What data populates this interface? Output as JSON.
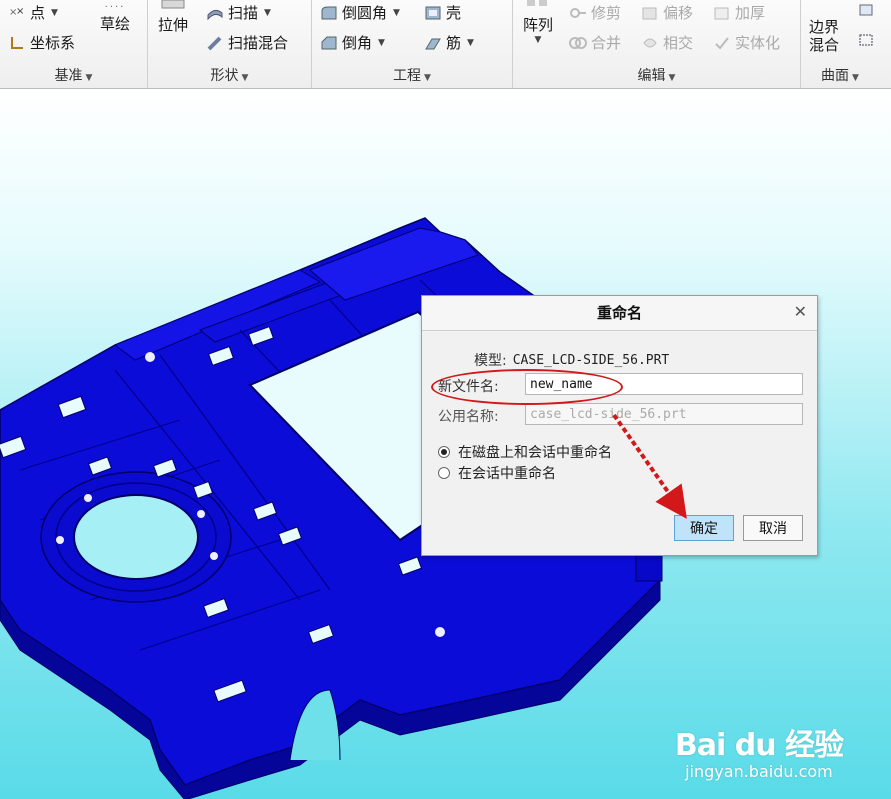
{
  "ribbon": {
    "groups": [
      {
        "label": "基准"
      },
      {
        "label": "形状"
      },
      {
        "label": "工程"
      },
      {
        "label": "编辑"
      },
      {
        "label": "曲面"
      }
    ],
    "datum": {
      "point": "点",
      "csys": "坐标系",
      "sketch": "草绘"
    },
    "shapes": {
      "extrude": "拉伸",
      "sweep": "扫描",
      "swept_blend": "扫描混合"
    },
    "engineering": {
      "round": "倒圆角",
      "chamfer": "倒角",
      "shell": "壳",
      "rib": "筋"
    },
    "editing": {
      "pattern": "阵列",
      "trim": "修剪",
      "merge": "合并",
      "offset": "偏移",
      "intersect": "相交",
      "thicken": "加厚",
      "solidify": "实体化"
    },
    "surfaces": {
      "boundary_blend_1": "边界",
      "boundary_blend_2": "混合"
    }
  },
  "dialog": {
    "title": "重命名",
    "model_label": "模型:",
    "model_value": "CASE_LCD-SIDE_56.PRT",
    "new_name_label": "新文件名:",
    "new_name_value": "new_name",
    "common_name_label": "公用名称:",
    "common_name_value": "case_lcd-side_56.prt",
    "options": [
      {
        "label": "在磁盘上和会话中重命名",
        "selected": true
      },
      {
        "label": "在会话中重命名",
        "selected": false
      }
    ],
    "ok_label": "确定",
    "cancel_label": "取消"
  },
  "watermark": {
    "brand": "Bai du 经验",
    "url": "jingyan.baidu.com"
  },
  "colors": {
    "model": "#0c0cd8",
    "annotation": "#d21818",
    "ok_button": "#bfe3f8"
  }
}
